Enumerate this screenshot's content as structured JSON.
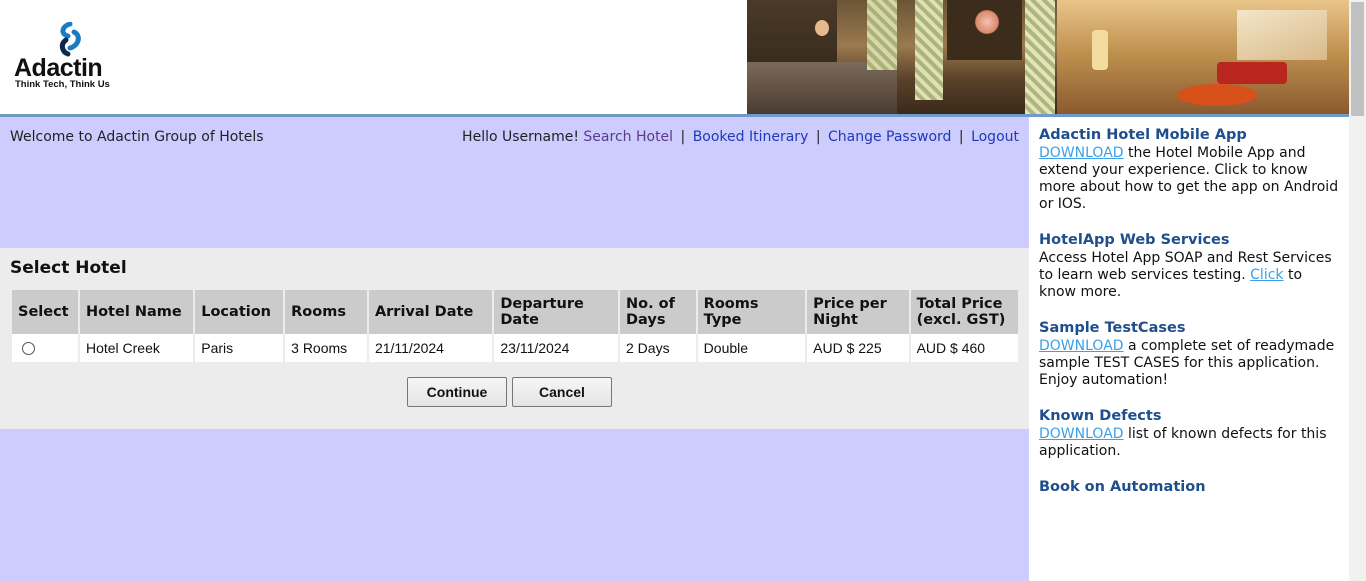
{
  "logo": {
    "name": "Adactin",
    "tagline": "Think Tech, Think Us"
  },
  "header": {
    "welcome": "Welcome to Adactin Group of Hotels"
  },
  "nav": {
    "greeting": "Hello Username!",
    "links": [
      "Search Hotel",
      "Booked Itinerary",
      "Change Password",
      "Logout"
    ]
  },
  "select_hotel": {
    "title": "Select Hotel",
    "columns": [
      "Select",
      "Hotel Name",
      "Location",
      "Rooms",
      "Arrival Date",
      "Departure Date",
      "No. of Days",
      "Rooms Type",
      "Price per Night",
      "Total Price (excl. GST)"
    ],
    "rows": [
      {
        "hotel_name": "Hotel Creek",
        "location": "Paris",
        "rooms": "3 Rooms",
        "arrival": "21/11/2024",
        "departure": "23/11/2024",
        "days": "2 Days",
        "room_type": "Double",
        "price_per_night": "AUD $ 225",
        "total_price": "AUD $ 460"
      }
    ],
    "continue_label": "Continue",
    "cancel_label": "Cancel"
  },
  "sidebar": {
    "mobile_app": {
      "title": "Adactin Hotel Mobile App",
      "link": "DOWNLOAD",
      "text": " the Hotel Mobile App and extend your experience. Click to know more about how to get the app on Android or IOS."
    },
    "web_services": {
      "title": "HotelApp Web Services",
      "text_before": "Access Hotel App SOAP and Rest Services to learn web services testing. ",
      "link": "Click",
      "text_after": " to know more."
    },
    "test_cases": {
      "title": "Sample TestCases",
      "link": "DOWNLOAD",
      "text": " a complete set of readymade sample TEST CASES for this application. Enjoy automation!"
    },
    "known_defects": {
      "title": "Known Defects",
      "link": "DOWNLOAD",
      "text": " list of known defects for this application."
    },
    "book": {
      "title": "Book on Automation"
    }
  },
  "colors": {
    "content_bg": "#ccccff",
    "panel_bg": "#ececec",
    "header_bg": "#cbcbcb",
    "sidebar_heading": "#1f4e8c",
    "link": "#1f3ab8",
    "download_link": "#3aa0e8"
  }
}
